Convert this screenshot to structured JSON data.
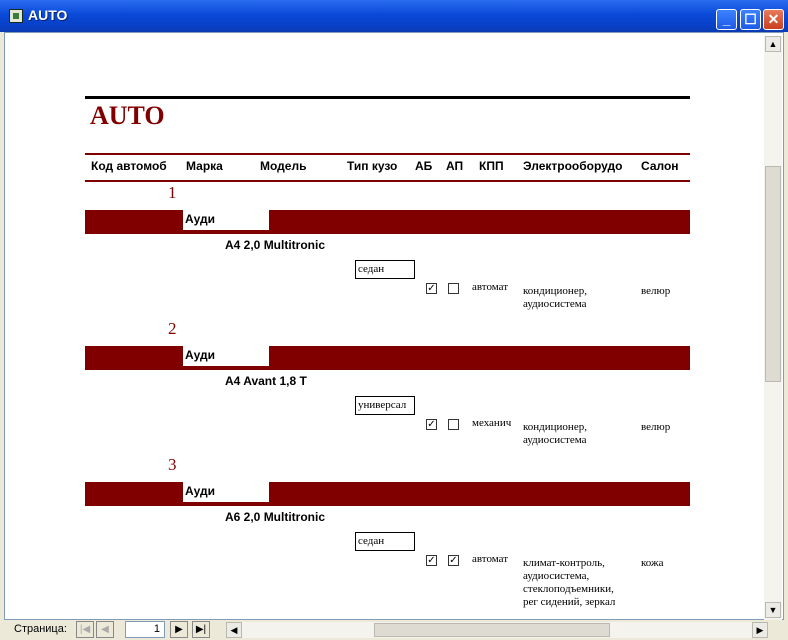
{
  "window": {
    "title": "AUTO"
  },
  "report": {
    "title": "AUTO",
    "columns": [
      "Код автомоб",
      "Марка",
      "Модель",
      "Тип кузо",
      "АБ",
      "АП",
      "КПП",
      "Электрооборудо",
      "Салон"
    ],
    "records": [
      {
        "num": "1",
        "brand": "Ауди",
        "model": "A4 2,0 Multitronic",
        "body": "седан",
        "ab": true,
        "ap": false,
        "kpp": "автомат",
        "elec": [
          "кондиционер,",
          "аудиосистема"
        ],
        "salon": "велюр"
      },
      {
        "num": "2",
        "brand": "Ауди",
        "model": "A4 Avant 1,8 T",
        "body": "универсал",
        "ab": true,
        "ap": false,
        "kpp": "механич",
        "elec": [
          "кондиционер,",
          "аудиосистема"
        ],
        "salon": "велюр"
      },
      {
        "num": "3",
        "brand": "Ауди",
        "model": "A6 2,0 Multitronic",
        "body": "седан",
        "ab": true,
        "ap": true,
        "kpp": "автомат",
        "elec": [
          "климат-контроль,",
          "аудиосистема,",
          "стеклоподъемники,",
          "рег сидений, зеркал"
        ],
        "salon": "кожа"
      }
    ]
  },
  "navigation": {
    "page_label": "Страница:",
    "page_value": "1"
  }
}
